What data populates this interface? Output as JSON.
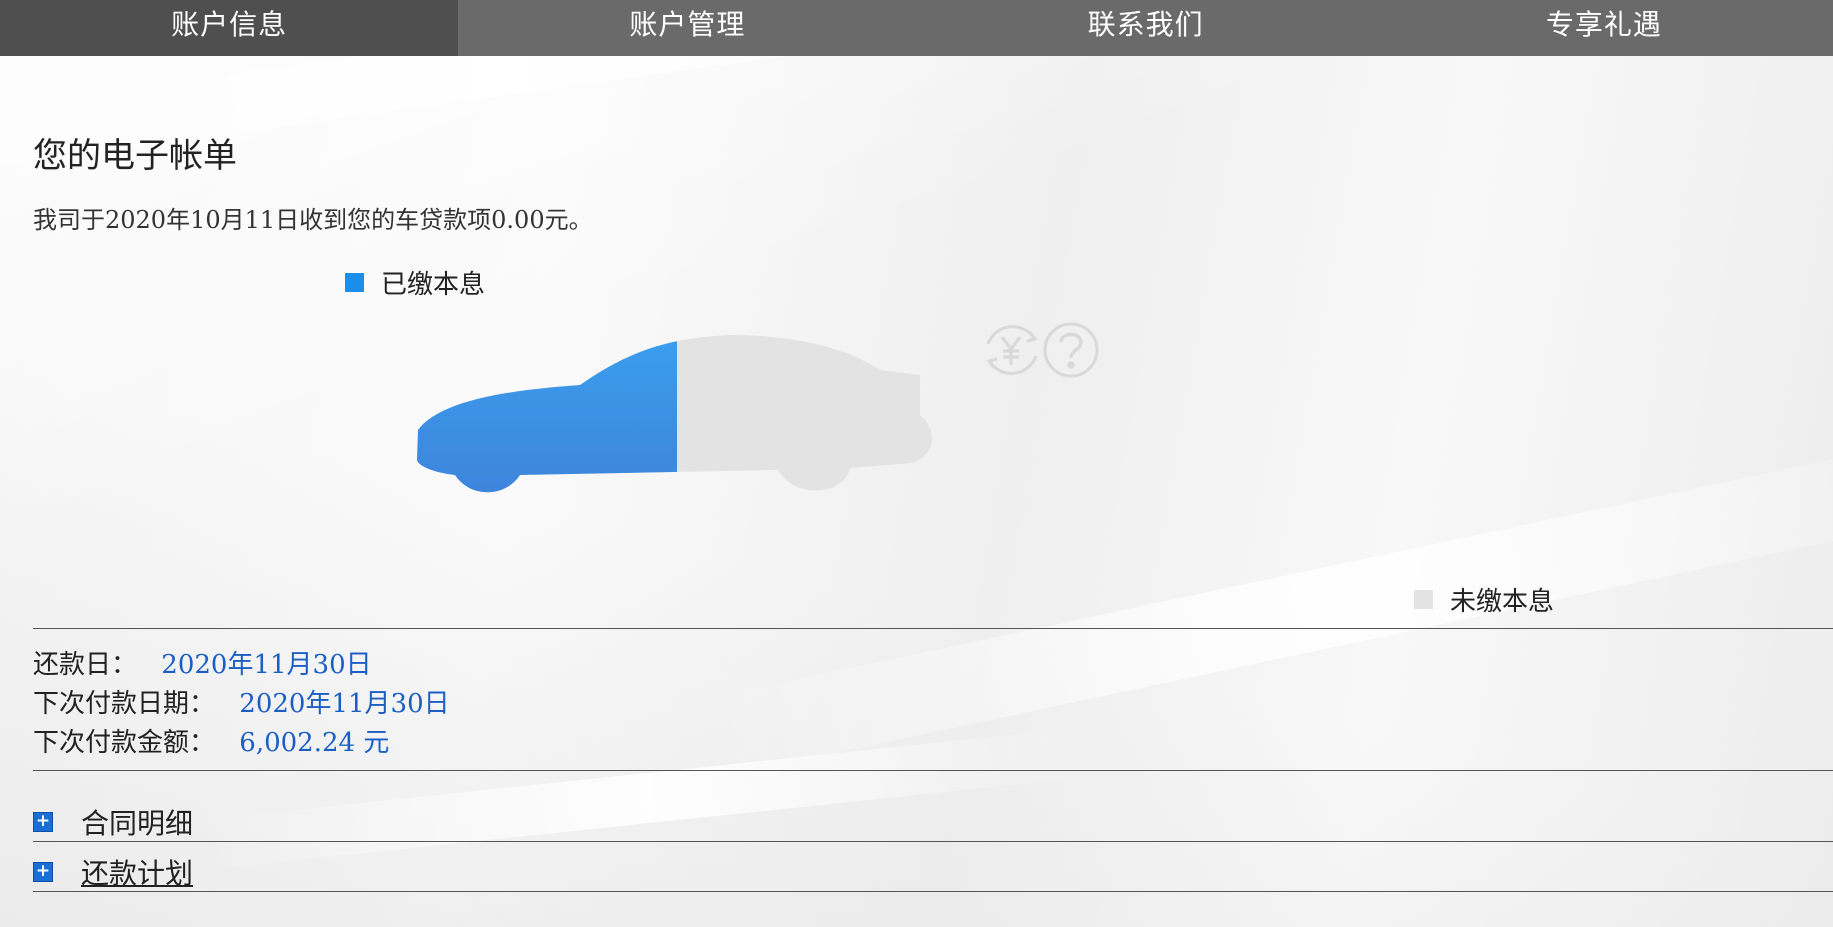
{
  "nav": {
    "tabs": [
      {
        "label": "账户信息",
        "active": true
      },
      {
        "label": "账户管理",
        "active": false
      },
      {
        "label": "联系我们",
        "active": false
      },
      {
        "label": "专享礼遇",
        "active": false
      }
    ]
  },
  "main": {
    "title": "您的电子帐单",
    "notice": "我司于2020年10月11日收到您的车贷款项0.00元。"
  },
  "legend": {
    "paid_label": "已缴本息",
    "unpaid_label": "未缴本息"
  },
  "progress": {
    "paid_fraction": 0.5
  },
  "colors": {
    "paid": "#2f8fe8",
    "unpaid": "#e3e3e3",
    "nav_bg": "#6a6a6a",
    "nav_active": "#4f4f4f",
    "value_text": "#1b5fc4"
  },
  "icons": [
    "yuan-exchange-icon",
    "help-question-icon",
    "expand-plus-icon"
  ],
  "payment": {
    "due_day_label": "还款日：",
    "due_day_value": "2020年11月30日",
    "next_date_label": "下次付款日期：",
    "next_date_value": "2020年11月30日",
    "next_amount_label": "下次付款金额：",
    "next_amount_value": "6,002.24 元"
  },
  "sections": [
    {
      "label": "合同明细"
    },
    {
      "label": "还款计划"
    }
  ]
}
